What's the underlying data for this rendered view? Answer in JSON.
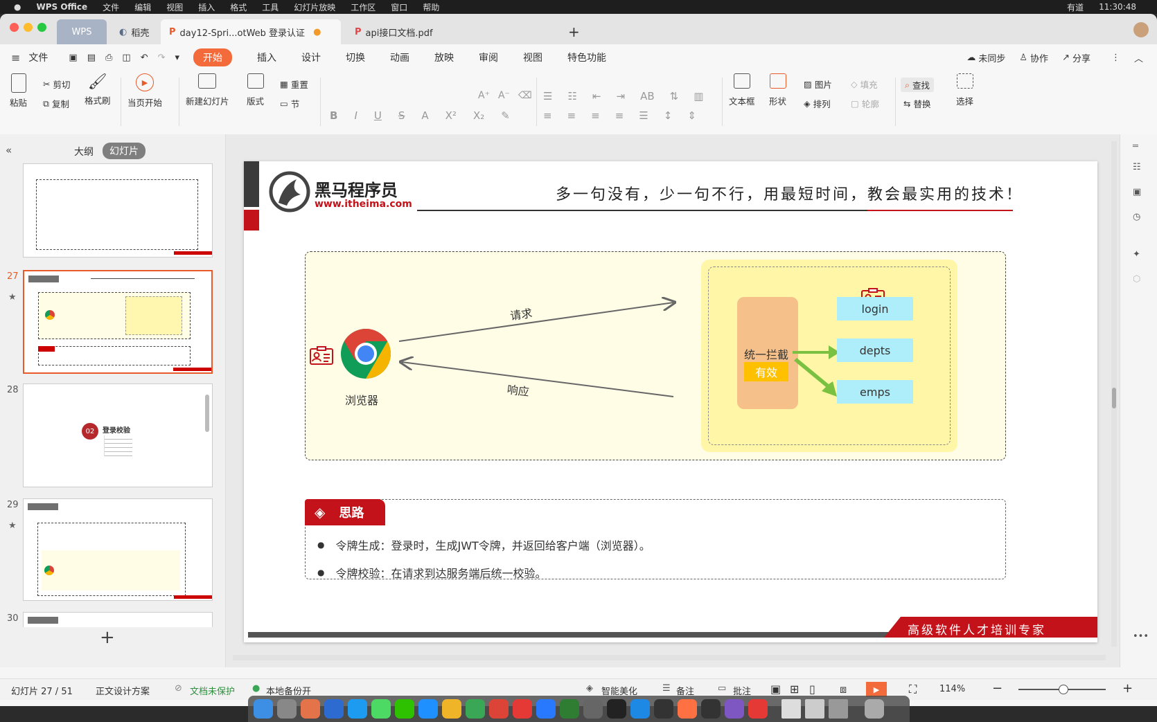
{
  "menubar": {
    "apple": "",
    "app": "WPS Office",
    "items": [
      "文件",
      "编辑",
      "视图",
      "插入",
      "格式",
      "工具",
      "幻灯片放映",
      "工作区",
      "窗口",
      "帮助"
    ],
    "right": "有道",
    "time": "11:30:48"
  },
  "tabs": {
    "home": "WPS",
    "t1": "稻壳",
    "t2": "day12-Spri...otWeb 登录认证",
    "t3": "api接口文档.pdf",
    "plus": "+"
  },
  "menu": {
    "file": "文件",
    "tabs": [
      "开始",
      "插入",
      "设计",
      "切换",
      "动画",
      "放映",
      "审阅",
      "视图",
      "特色功能"
    ],
    "sync": "未同步",
    "collab": "协作",
    "share": "分享"
  },
  "ribbon": {
    "paste": "粘贴",
    "cut": "剪切",
    "copy": "复制",
    "brush": "格式刷",
    "play": "当页开始",
    "newslide": "新建幻灯片",
    "layout": "版式",
    "reset": "重置",
    "section": "节",
    "textbox": "文本框",
    "shape": "形状",
    "picture": "图片",
    "arrange": "排列",
    "fill": "填充",
    "outline": "轮廓",
    "find": "查找",
    "replace": "替换",
    "select": "选择"
  },
  "leftpanel": {
    "outline": "大纲",
    "slides": "幻灯片",
    "n27": "27",
    "n28": "28",
    "n29": "29",
    "n30": "30",
    "t28badge": "02",
    "t28title": "登录校验",
    "add": "+"
  },
  "slide": {
    "logo_cn": "黑马程序员",
    "logo_url": "www.itheima.com",
    "slogan": "多一句没有，少一句不行，用最短时间，教会最实用的技术！",
    "browser": "浏览器",
    "request": "请求",
    "response": "响应",
    "intercept": "统一拦截",
    "valid": "有效",
    "login": "login",
    "depts": "depts",
    "emps": "emps",
    "idea": "思路",
    "bullet1": "令牌生成：登录时，生成JWT令牌，并返回给客户端（浏览器）。",
    "bullet2": "令牌校验：在请求到达服务端后统一校验。",
    "footer": "高级软件人才培训专家"
  },
  "status": {
    "slide": "幻灯片 27 / 51",
    "design": "正文设计方案",
    "protect": "文档未保护",
    "backup": "本地备份开",
    "beautify": "智能美化",
    "notes": "备注",
    "comment": "批注",
    "zoom": "114%"
  }
}
